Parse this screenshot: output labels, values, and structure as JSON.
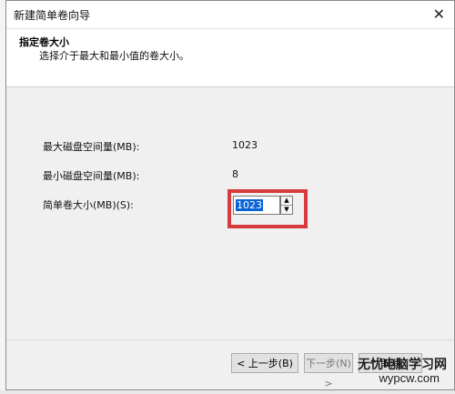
{
  "window": {
    "title": "新建简单卷向导"
  },
  "header": {
    "title": "指定卷大小",
    "subtitle": "选择介于最大和最小值的卷大小。"
  },
  "fields": {
    "max_label": "最大磁盘空间量(MB):",
    "max_value": "1023",
    "min_label": "最小磁盘空间量(MB):",
    "min_value": "8",
    "size_label": "简单卷大小(MB)(S):",
    "size_value": "1023"
  },
  "buttons": {
    "back": "< 上一步(B)",
    "next": "下一步(N) >",
    "cancel": "取消"
  },
  "watermark": {
    "line1": "无忧电脑学习网",
    "line2": "wypcw.com"
  },
  "colors": {
    "highlight": "#d83b3b",
    "selection": "#0a64d8"
  }
}
